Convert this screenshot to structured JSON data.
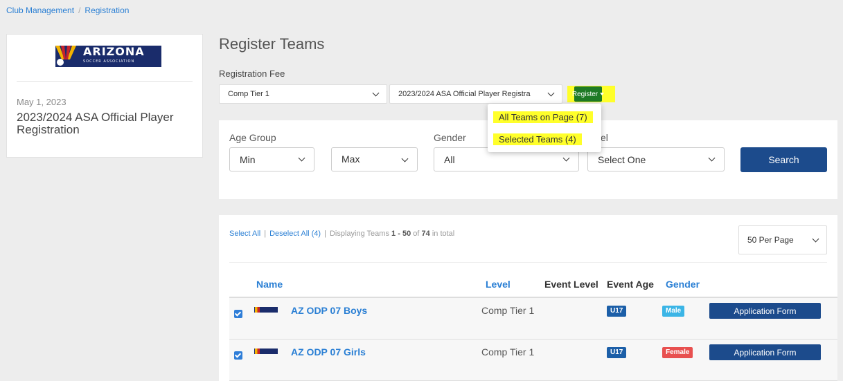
{
  "breadcrumb": {
    "items": [
      "Club Management",
      "Registration"
    ],
    "separator": "/"
  },
  "event": {
    "logo_text": "ARIZONA",
    "logo_subtext": "SOCCER ASSOCIATION",
    "date": "May 1, 2023",
    "title": "2023/2024 ASA Official Player Registration"
  },
  "page": {
    "title": "Register Teams",
    "fee_label": "Registration Fee"
  },
  "fee_selects": {
    "tier": "Comp Tier 1",
    "registration": "2023/2024 ASA Official Player Registra"
  },
  "register_button": {
    "label": "Register"
  },
  "register_menu": {
    "items": [
      "All Teams on Page (7)",
      "Selected Teams (4)"
    ]
  },
  "filters": {
    "age_group_label": "Age Group",
    "age_min": "Min",
    "age_max": "Max",
    "gender_label": "Gender",
    "gender_value": "All",
    "level_label_partial": "el",
    "level_value": "Select One",
    "search_label": "Search"
  },
  "toolbar": {
    "select_all": "Select All",
    "deselect_all": "Deselect All (4)",
    "displaying_prefix": "Displaying Teams",
    "range_start": "1",
    "range_sep": "-",
    "range_end": "50",
    "of": "of",
    "total": "74",
    "in_total": "in total",
    "per_page": "50 Per Page"
  },
  "table": {
    "headers": {
      "name": "Name",
      "level": "Level",
      "event_level": "Event Level",
      "event_age": "Event Age",
      "gender": "Gender"
    },
    "rows": [
      {
        "name": "AZ ODP 07 Boys",
        "level": "Comp Tier 1",
        "event_age": "U17",
        "gender": "Male",
        "action": "Application Form",
        "checked": true
      },
      {
        "name": "AZ ODP 07 Girls",
        "level": "Comp Tier 1",
        "event_age": "U17",
        "gender": "Female",
        "action": "Application Form",
        "checked": true
      }
    ]
  },
  "colors": {
    "link": "#2a7fd4",
    "primary": "#1c4b8c",
    "register_green": "#1e7a25",
    "highlight": "#ffff2a",
    "male": "#3bb5e6",
    "female": "#e8504f"
  }
}
